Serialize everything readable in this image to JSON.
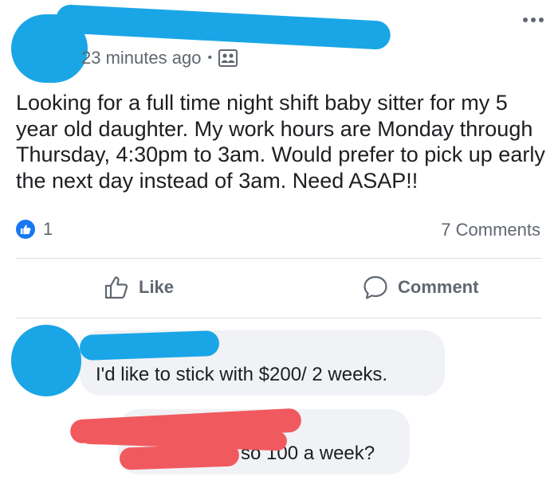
{
  "post": {
    "timestamp": "23 minutes ago",
    "separator": "•",
    "privacy_icon": "friends-icon",
    "text": "Looking for a full time night shift baby sitter for my 5 year old daughter. My work hours are Monday through Thursday, 4:30pm to 3am. Would prefer to pick up early the next day instead of 3am. Need ASAP!!",
    "reaction_count": "1",
    "comments_label": "7 Comments"
  },
  "actions": {
    "like_label": "Like",
    "comment_label": "Comment"
  },
  "comments": [
    {
      "text": "I'd like to stick with $200/ 2 weeks."
    },
    {
      "text": "so 100 a week?"
    }
  ],
  "colors": {
    "redaction_blue": "#1aa6e6",
    "redaction_red": "#f05a5f",
    "like_blue": "#1877f2",
    "meta_gray": "#606770",
    "bubble_bg": "#f0f2f5"
  }
}
